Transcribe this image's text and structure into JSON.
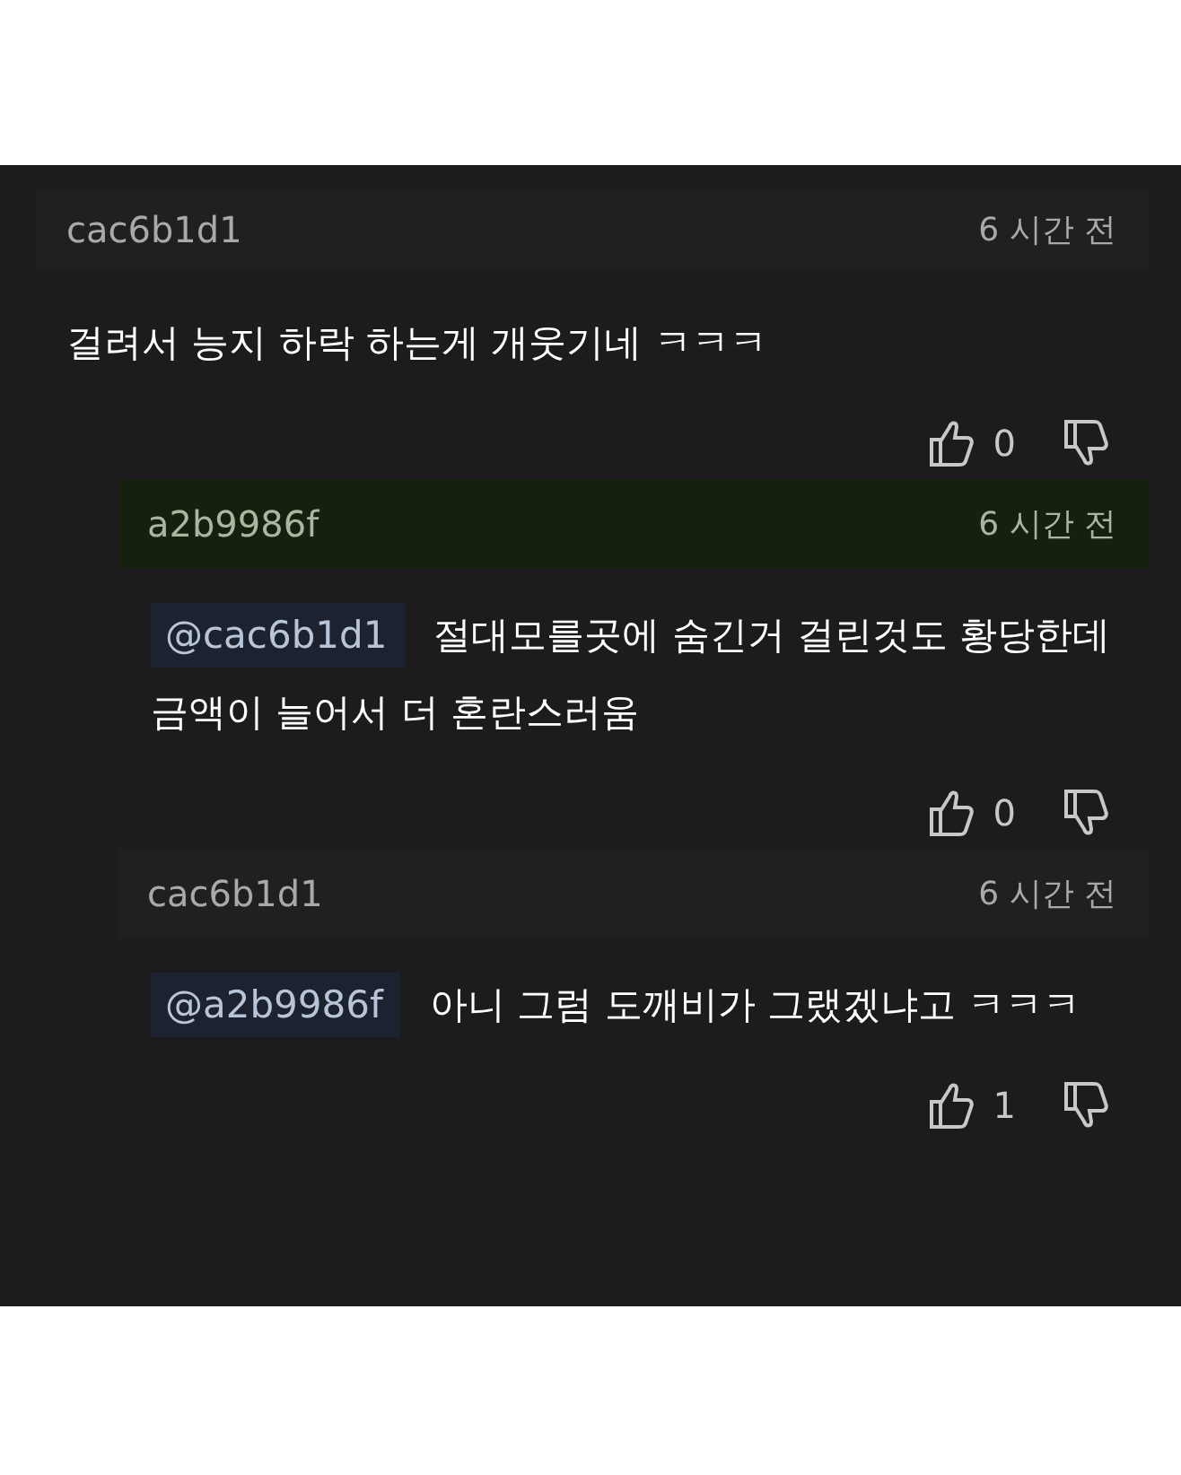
{
  "comments": [
    {
      "author": "cac6b1d1",
      "time": "6 시간 전",
      "highlighted": false,
      "body": "걸려서 능지 하락 하는게 개웃기네 ㅋㅋㅋ",
      "likes": "0",
      "replies": [
        {
          "author": "a2b9986f",
          "time": "6 시간 전",
          "highlighted": true,
          "mention": "@cac6b1d1",
          "body": "절대모를곳에 숨긴거 걸린것도 황당한데\n금액이 늘어서 더 혼란스러움",
          "likes": "0"
        },
        {
          "author": "cac6b1d1",
          "time": "6 시간 전",
          "highlighted": false,
          "mention": "@a2b9986f",
          "body": "아니 그럼 도깨비가 그랬겠냐고 ㅋㅋㅋ",
          "likes": "1"
        }
      ]
    }
  ]
}
